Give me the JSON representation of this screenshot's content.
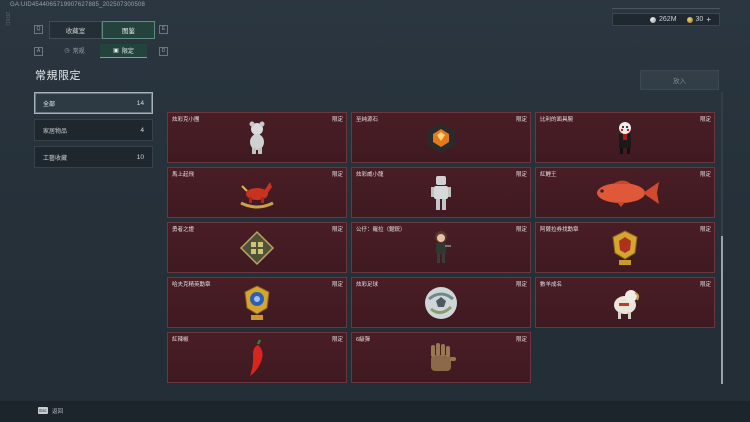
{
  "header": {
    "uid": "GA:UID4544065719907627885_202507300508",
    "side_label": "ZRKD",
    "currency": [
      {
        "icon": "silver-coin-icon",
        "value": "262M"
      },
      {
        "icon": "gold-coin-icon",
        "value": "30"
      }
    ],
    "add_label": "+"
  },
  "tabs": {
    "prev_key": "Q",
    "next_key": "E",
    "items": [
      {
        "label": "收藏室",
        "active": false
      },
      {
        "label": "图鉴",
        "active": true
      }
    ]
  },
  "subtabs": {
    "prev_key": "A",
    "next_key": "D",
    "items": [
      {
        "label": "常规",
        "icon": "clock-icon",
        "active": false
      },
      {
        "label": "限定",
        "icon": "gallery-icon",
        "active": true
      }
    ]
  },
  "section": {
    "title": "常規限定",
    "action_label": "放入"
  },
  "filters": [
    {
      "label": "全部",
      "count": "14",
      "active": true
    },
    {
      "label": "家居物品",
      "count": "4",
      "active": false
    },
    {
      "label": "工藝收藏",
      "count": "10",
      "active": false
    }
  ],
  "cards": [
    {
      "name": "炫彩克小團",
      "tag": "限定",
      "art": "bear-figure-icon"
    },
    {
      "name": "至純源石",
      "tag": "限定",
      "art": "amber-gem-icon"
    },
    {
      "name": "比利的面具腕",
      "tag": "限定",
      "art": "puppet-figure-icon"
    },
    {
      "name": "馬上起飛",
      "tag": "限定",
      "art": "rocking-horse-icon"
    },
    {
      "name": "炫彩威小龍",
      "tag": "限定",
      "art": "robot-figure-icon"
    },
    {
      "name": "紅鯉王",
      "tag": "限定",
      "art": "red-carp-icon"
    },
    {
      "name": "勇者之證",
      "tag": "限定",
      "art": "emblem-plaque-icon"
    },
    {
      "name": "公仔：羅拉（鋸銃）",
      "tag": "限定",
      "art": "girl-figure-icon"
    },
    {
      "name": "阿薩拉券找勳章",
      "tag": "限定",
      "art": "gold-medal-icon"
    },
    {
      "name": "哈夫克精英勳章",
      "tag": "限定",
      "art": "blue-medal-icon"
    },
    {
      "name": "炫彩足球",
      "tag": "限定",
      "art": "soccer-ball-icon"
    },
    {
      "name": "數羊成名",
      "tag": "限定",
      "art": "sheep-figure-icon"
    },
    {
      "name": "紅辣椒",
      "tag": "限定",
      "art": "red-chili-icon"
    },
    {
      "name": "6級彈",
      "tag": "限定",
      "art": "glove-hand-icon"
    }
  ],
  "footer": {
    "back_key": "Esc",
    "back_label": "返回"
  },
  "colors": {
    "card_bg": "#4a1d25",
    "active_tab": "#24433d",
    "page_bg": "#26313a"
  }
}
